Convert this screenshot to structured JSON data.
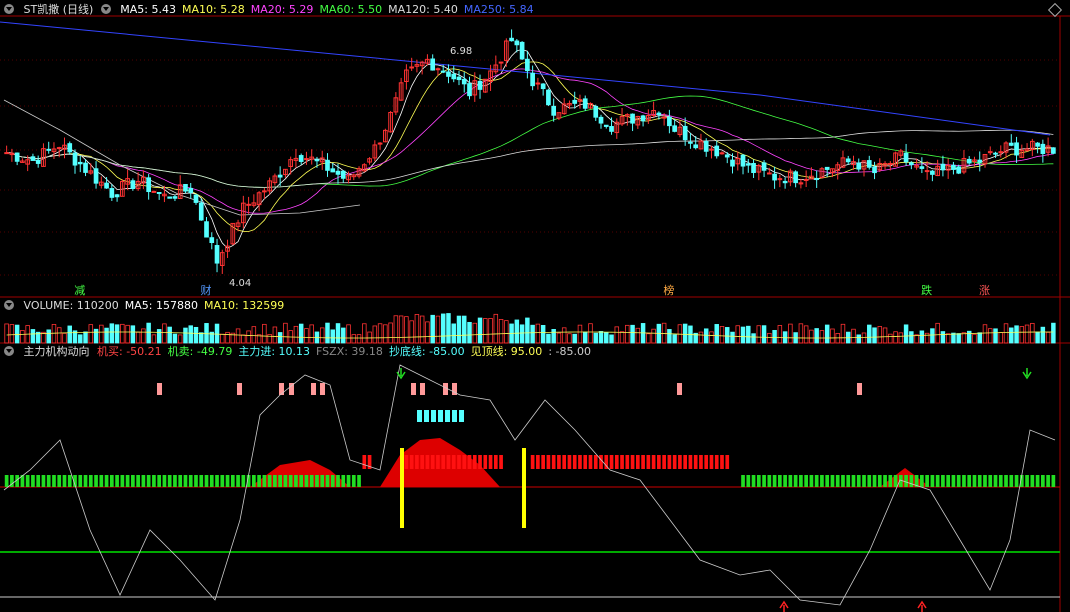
{
  "header": {
    "title": "ST凯撒 (日线)",
    "ma_items": [
      {
        "label": "MA5: 5.43",
        "color": "#ffffff"
      },
      {
        "label": "MA10: 5.28",
        "color": "#ffff55"
      },
      {
        "label": "MA20: 5.29",
        "color": "#ff44ff"
      },
      {
        "label": "MA60: 5.50",
        "color": "#44ff44"
      },
      {
        "label": "MA120: 5.40",
        "color": "#dddddd"
      },
      {
        "label": "MA250: 5.84",
        "color": "#4466ff"
      }
    ]
  },
  "volume_header": {
    "items": [
      {
        "label": "VOLUME: 110200",
        "color": "#dddddd"
      },
      {
        "label": "MA5: 157880",
        "color": "#ffffff"
      },
      {
        "label": "MA10: 132599",
        "color": "#ffff55"
      }
    ]
  },
  "indicator_header": {
    "name": "主力机构动向",
    "items": [
      {
        "label": "机买: -50.21",
        "color": "#ff4444"
      },
      {
        "label": "机卖: -49.79",
        "color": "#44ff44"
      },
      {
        "label": "主力进: 10.13",
        "color": "#55ffff"
      },
      {
        "label": "FSZX: 39.18",
        "color": "#888888"
      },
      {
        "label": "抄底线: -85.00",
        "color": "#55ffff"
      },
      {
        "label": "见顶线: 95.00",
        "color": "#ffff55"
      },
      {
        "label": ": -85.00",
        "color": "#cccccc"
      }
    ]
  },
  "tags": [
    {
      "text": "减",
      "color": "#44ff44",
      "pos": 14
    },
    {
      "text": "财",
      "color": "#5599ff",
      "pos": 38
    },
    {
      "text": "榜",
      "color": "#ffaa44",
      "pos": 126
    },
    {
      "text": "跌",
      "color": "#44ff44",
      "pos": 175
    },
    {
      "text": "涨",
      "color": "#ff5555",
      "pos": 186
    }
  ],
  "colors": {
    "up": "#ff3333",
    "down": "#55ffff",
    "bg": "#000000"
  },
  "chart_data": {
    "type": "candlestick",
    "annotations": [
      {
        "text": "6.98",
        "at": 82
      },
      {
        "text": "4.04",
        "at": 40
      }
    ],
    "price_range": [
      3.9,
      7.2
    ],
    "ohlc_anchors": [
      [
        0,
        5.55
      ],
      [
        5,
        5.45
      ],
      [
        10,
        5.65
      ],
      [
        15,
        5.35
      ],
      [
        20,
        5.05
      ],
      [
        25,
        5.2
      ],
      [
        30,
        5.0
      ],
      [
        35,
        5.1
      ],
      [
        40,
        4.2
      ],
      [
        45,
        4.85
      ],
      [
        50,
        5.15
      ],
      [
        55,
        5.55
      ],
      [
        60,
        5.4
      ],
      [
        65,
        5.2
      ],
      [
        70,
        5.6
      ],
      [
        73,
        6.0
      ],
      [
        76,
        6.5
      ],
      [
        80,
        6.7
      ],
      [
        84,
        6.55
      ],
      [
        88,
        6.3
      ],
      [
        92,
        6.55
      ],
      [
        96,
        6.95
      ],
      [
        100,
        6.45
      ],
      [
        104,
        6.1
      ],
      [
        110,
        6.15
      ],
      [
        115,
        5.9
      ],
      [
        120,
        6.0
      ],
      [
        124,
        6.1
      ],
      [
        127,
        5.85
      ],
      [
        131,
        5.7
      ],
      [
        136,
        5.55
      ],
      [
        141,
        5.35
      ],
      [
        146,
        5.25
      ],
      [
        151,
        5.25
      ],
      [
        156,
        5.35
      ],
      [
        161,
        5.45
      ],
      [
        165,
        5.3
      ],
      [
        170,
        5.5
      ],
      [
        175,
        5.25
      ],
      [
        180,
        5.35
      ],
      [
        185,
        5.45
      ],
      [
        190,
        5.6
      ]
    ]
  }
}
